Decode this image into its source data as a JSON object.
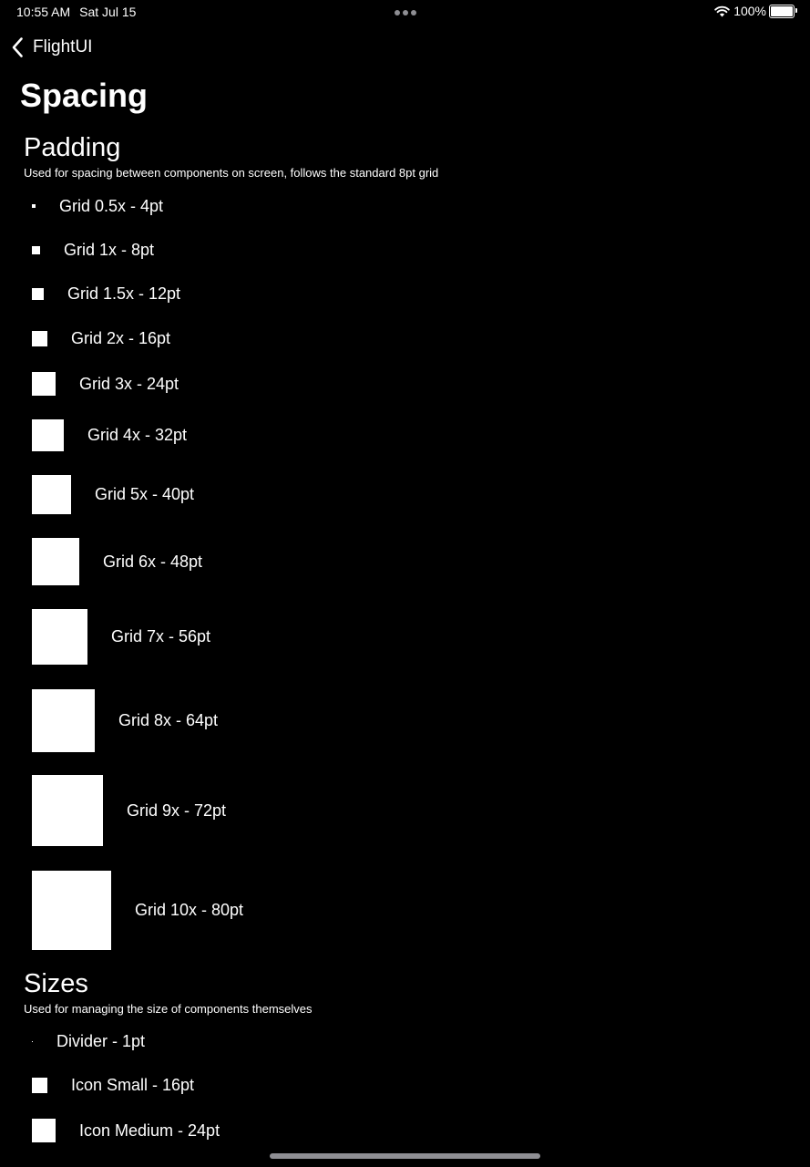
{
  "status_bar": {
    "time": "10:55 AM",
    "date": "Sat Jul 15",
    "battery": "100%"
  },
  "nav": {
    "back_label": "FlightUI"
  },
  "page_title": "Spacing",
  "padding_section": {
    "title": "Padding",
    "subtitle": "Used for spacing between components on screen, follows the standard 8pt grid",
    "items": [
      {
        "label": "Grid 0.5x - 4pt",
        "pt": 4
      },
      {
        "label": "Grid 1x - 8pt",
        "pt": 8
      },
      {
        "label": "Grid 1.5x - 12pt",
        "pt": 12
      },
      {
        "label": "Grid 2x - 16pt",
        "pt": 16
      },
      {
        "label": "Grid 3x - 24pt",
        "pt": 24
      },
      {
        "label": "Grid 4x - 32pt",
        "pt": 32
      },
      {
        "label": "Grid 5x - 40pt",
        "pt": 40
      },
      {
        "label": "Grid 6x - 48pt",
        "pt": 48
      },
      {
        "label": "Grid 7x - 56pt",
        "pt": 56
      },
      {
        "label": "Grid 8x - 64pt",
        "pt": 64
      },
      {
        "label": "Grid 9x - 72pt",
        "pt": 72
      },
      {
        "label": "Grid 10x - 80pt",
        "pt": 80
      }
    ]
  },
  "sizes_section": {
    "title": "Sizes",
    "subtitle": "Used for managing the size of components themselves",
    "items": [
      {
        "label": "Divider - 1pt",
        "pt": 1
      },
      {
        "label": "Icon Small - 16pt",
        "pt": 16
      },
      {
        "label": "Icon Medium - 24pt",
        "pt": 24
      }
    ]
  },
  "colors": {
    "background": "#000000",
    "foreground": "#ffffff",
    "secondary": "#8e8e93"
  },
  "icons": {
    "back": "chevron-left-icon",
    "wifi": "wifi-icon",
    "battery": "battery-icon"
  }
}
